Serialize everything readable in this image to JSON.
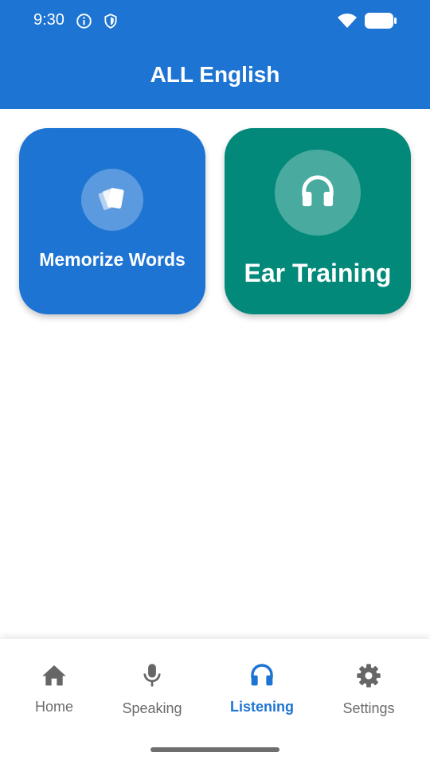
{
  "status_bar": {
    "time": "9:30",
    "icons": [
      "info-icon",
      "shield-icon",
      "wifi-icon",
      "battery-icon"
    ]
  },
  "app_bar": {
    "title": "ALL English",
    "color": "#1d74d3"
  },
  "cards": [
    {
      "label": "Memorize Words",
      "icon": "cards-icon",
      "color": "#1d74d3"
    },
    {
      "label": "Ear Training",
      "icon": "headphones-icon",
      "color": "#03897a"
    }
  ],
  "bottom_nav": {
    "active": "Listening",
    "active_color": "#1d74d3",
    "items": [
      {
        "label": "Home",
        "icon": "home-icon"
      },
      {
        "label": "Speaking",
        "icon": "mic-icon"
      },
      {
        "label": "Listening",
        "icon": "headphones-icon"
      },
      {
        "label": "Settings",
        "icon": "gear-icon"
      }
    ]
  }
}
